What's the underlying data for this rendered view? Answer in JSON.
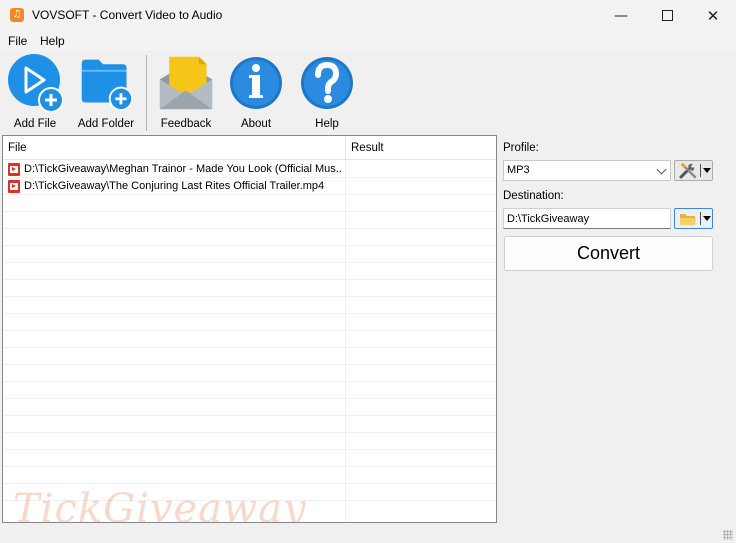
{
  "window": {
    "title": "VOVSOFT - Convert Video to Audio",
    "minimize_glyph": "—",
    "close_glyph": "✕"
  },
  "menu": [
    "File",
    "Help"
  ],
  "toolbar": {
    "add_file": "Add File",
    "add_folder": "Add Folder",
    "feedback": "Feedback",
    "about": "About",
    "help": "Help"
  },
  "files": {
    "columns": [
      "File",
      "Result"
    ],
    "rows": [
      {
        "file": "D:\\TickGiveaway\\Meghan Trainor - Made You Look (Official Mus...",
        "result": ""
      },
      {
        "file": "D:\\TickGiveaway\\The Conjuring Last Rites Official Trailer.mp4",
        "result": ""
      }
    ],
    "watermark": "TickGiveaway"
  },
  "profile": {
    "label": "Profile:",
    "value": "MP3"
  },
  "destination": {
    "label": "Destination:",
    "value": "D:\\TickGiveaway"
  },
  "convert_label": "Convert",
  "colors": {
    "icon_blue": "#1e90e6",
    "feedback_yellow": "#f5c518",
    "file_icon_red": "#d9342b",
    "app_icon_orange": "#f08a24"
  },
  "icons": {
    "app": "music-note-icon",
    "add_file": "play-plus-icon",
    "add_folder": "folder-plus-icon",
    "feedback": "envelope-icon",
    "about": "info-icon",
    "help": "question-icon",
    "profile_settings": "tools-icon",
    "destination_browse": "folder-icon"
  }
}
